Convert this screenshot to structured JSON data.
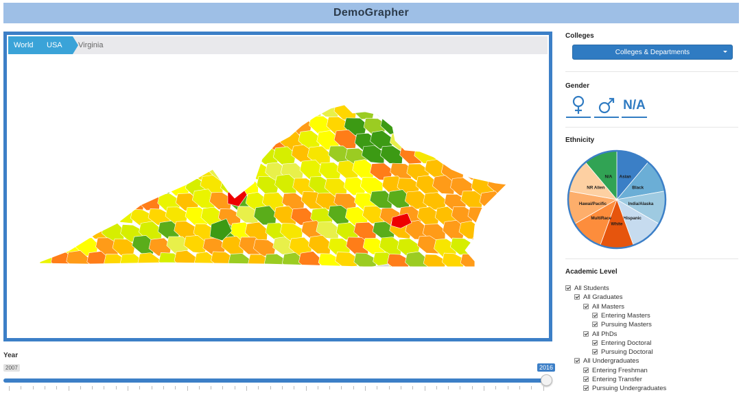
{
  "app": {
    "title": "DemoGrapher"
  },
  "breadcrumb": {
    "items": [
      "World",
      "USA",
      "Virginia"
    ]
  },
  "map": {
    "palette": [
      "#ffff00",
      "#eaf400",
      "#d6ee00",
      "#ffd600",
      "#ffbf00",
      "#ff9b18",
      "#ff7d18",
      "#9bcc22",
      "#5aad1a",
      "#e8f04a",
      "#f7e600"
    ],
    "hot_color": "#ee0000",
    "good_color": "#3c9a14",
    "na_color": "#d8d8d8"
  },
  "year": {
    "label": "Year",
    "min": "2007",
    "max": "2016",
    "value": 2016
  },
  "colleges": {
    "title": "Colleges",
    "dropdown_label": "Colleges & Departments"
  },
  "gender": {
    "title": "Gender",
    "female_icon": "♀",
    "male_icon": "♂",
    "na_label": "N/A"
  },
  "ethnicity": {
    "title": "Ethnicity",
    "slices": [
      {
        "label": "Asian",
        "value": 1,
        "color": "#3b7fc6"
      },
      {
        "label": "Black",
        "value": 1,
        "color": "#6baed6"
      },
      {
        "label": "India/Alaska",
        "value": 1,
        "color": "#9ecae1"
      },
      {
        "label": "Hispanic",
        "value": 1,
        "color": "#c6dbef"
      },
      {
        "label": "White",
        "value": 1,
        "color": "#e6550d"
      },
      {
        "label": "MultiRace",
        "value": 1,
        "color": "#fd8d3c"
      },
      {
        "label": "Hawai/Pacific",
        "value": 1,
        "color": "#fdae6b"
      },
      {
        "label": "NR Alien",
        "value": 1,
        "color": "#fdd0a2"
      },
      {
        "label": "N/A",
        "value": 1,
        "color": "#31a354"
      }
    ]
  },
  "academic": {
    "title": "Academic Level",
    "items": [
      {
        "label": "All Students",
        "level": 0
      },
      {
        "label": "All Graduates",
        "level": 1
      },
      {
        "label": "All Masters",
        "level": 2
      },
      {
        "label": "Entering Masters",
        "level": 3
      },
      {
        "label": "Pursuing Masters",
        "level": 3
      },
      {
        "label": "All PhDs",
        "level": 2
      },
      {
        "label": "Entering Doctoral",
        "level": 3
      },
      {
        "label": "Pursuing Doctoral",
        "level": 3
      },
      {
        "label": "All Undergraduates",
        "level": 1
      },
      {
        "label": "Entering Freshman",
        "level": 2
      },
      {
        "label": "Entering Transfer",
        "level": 2
      },
      {
        "label": "Pursuing Undergraduates",
        "level": 2
      }
    ]
  }
}
